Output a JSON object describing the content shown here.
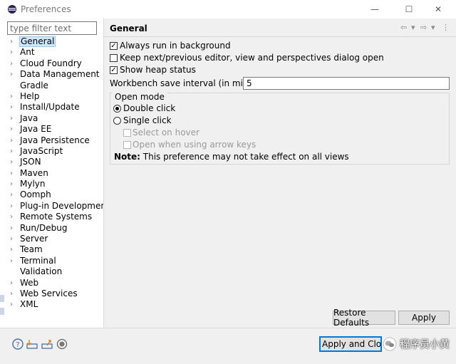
{
  "window": {
    "title": "Preferences",
    "minimize_glyph": "—",
    "maximize_glyph": "☐",
    "close_glyph": "✕"
  },
  "filter": {
    "placeholder": "type filter text",
    "value": ""
  },
  "tree": {
    "items": [
      {
        "label": "General",
        "expandable": true,
        "selected": true
      },
      {
        "label": "Ant",
        "expandable": true
      },
      {
        "label": "Cloud Foundry",
        "expandable": true
      },
      {
        "label": "Data Management",
        "expandable": true
      },
      {
        "label": "Gradle",
        "expandable": false
      },
      {
        "label": "Help",
        "expandable": true
      },
      {
        "label": "Install/Update",
        "expandable": true
      },
      {
        "label": "Java",
        "expandable": true
      },
      {
        "label": "Java EE",
        "expandable": true
      },
      {
        "label": "Java Persistence",
        "expandable": true
      },
      {
        "label": "JavaScript",
        "expandable": true
      },
      {
        "label": "JSON",
        "expandable": true
      },
      {
        "label": "Maven",
        "expandable": true
      },
      {
        "label": "Mylyn",
        "expandable": true
      },
      {
        "label": "Oomph",
        "expandable": true
      },
      {
        "label": "Plug-in Development",
        "expandable": true
      },
      {
        "label": "Remote Systems",
        "expandable": true
      },
      {
        "label": "Run/Debug",
        "expandable": true
      },
      {
        "label": "Server",
        "expandable": true
      },
      {
        "label": "Team",
        "expandable": true
      },
      {
        "label": "Terminal",
        "expandable": true
      },
      {
        "label": "Validation",
        "expandable": false
      },
      {
        "label": "Web",
        "expandable": true
      },
      {
        "label": "Web Services",
        "expandable": true
      },
      {
        "label": "XML",
        "expandable": true
      }
    ]
  },
  "page": {
    "title": "General",
    "options": {
      "run_background": {
        "label": "Always run in background",
        "checked": true
      },
      "keep_dialog": {
        "label": "Keep next/previous editor, view and perspectives dialog open",
        "checked": false
      },
      "heap_status": {
        "label": "Show heap status",
        "checked": true
      }
    },
    "interval": {
      "label": "Workbench save interval (in minutes):",
      "value": "5"
    },
    "open_mode": {
      "label": "Open mode",
      "double_click": "Double click",
      "single_click": "Single click",
      "select_on_hover": "Select on hover",
      "open_arrow_keys": "Open when using arrow keys",
      "selected": "Double click"
    },
    "note": {
      "bold": "Note:",
      "text": " This preference may not take effect on all views"
    },
    "buttons": {
      "restore": "Restore Defaults",
      "apply": "Apply"
    }
  },
  "bottom": {
    "apply_close": "Apply and Close",
    "watermark": "程序员小黄"
  },
  "colors": {
    "selection": "#cce8ff",
    "focus_border": "#0078d7",
    "panel_bg": "#f0f0f0"
  }
}
